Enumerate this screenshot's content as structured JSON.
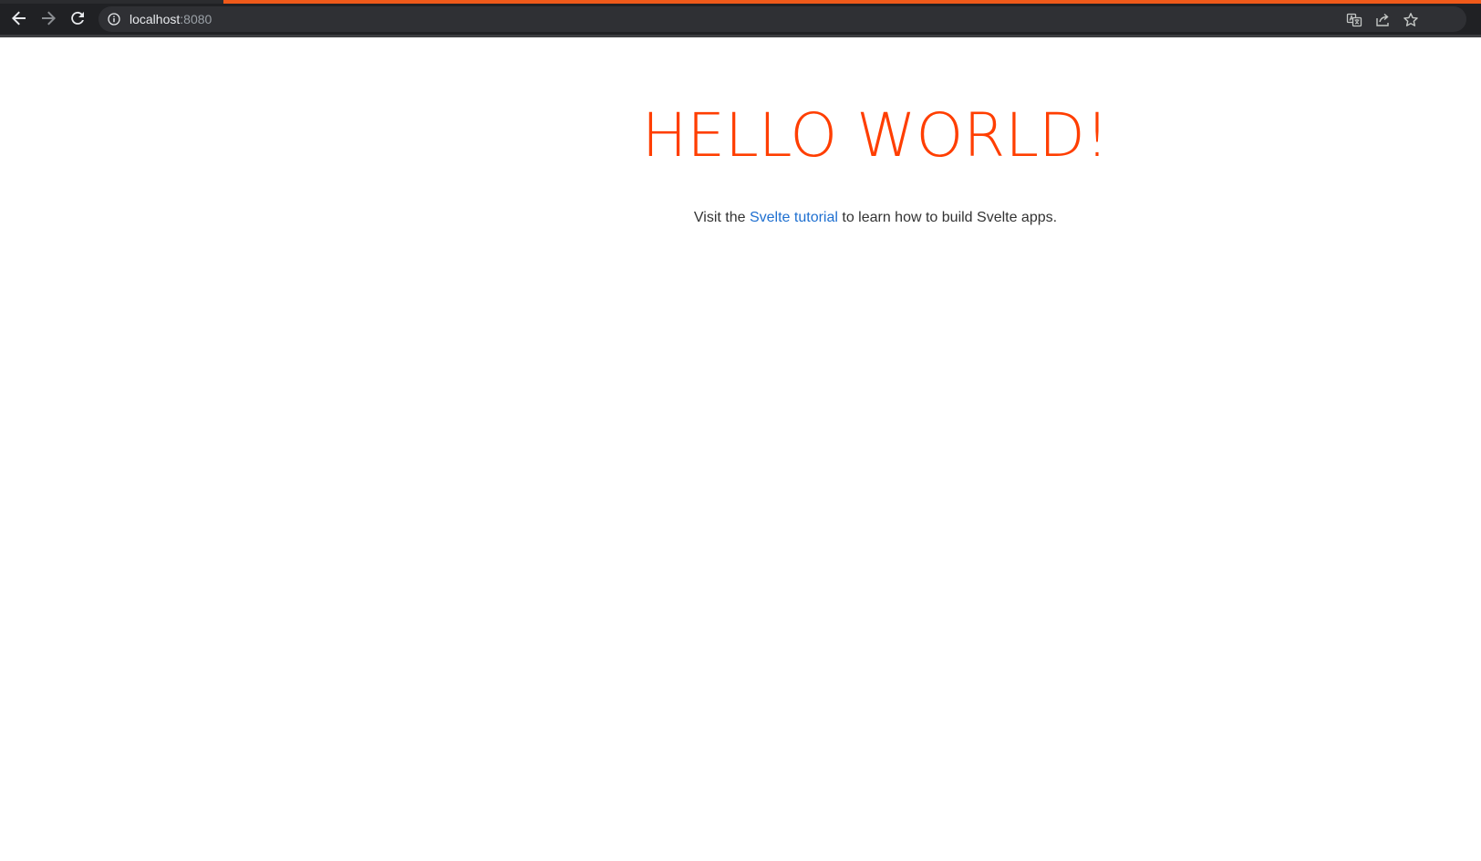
{
  "browser": {
    "url_host": "localhost",
    "url_port": ":8080",
    "accent_color": "#f05a1a",
    "icons": {
      "back": "arrow-left-icon",
      "forward": "arrow-right-icon",
      "reload": "reload-icon",
      "site_info": "info-icon",
      "translate": "translate-icon",
      "share": "share-icon",
      "bookmark": "star-icon"
    }
  },
  "page": {
    "heading": "HELLO WORLD!",
    "heading_color": "#ff3e00",
    "intro_before": "Visit the ",
    "link_text": "Svelte tutorial",
    "intro_after": " to learn how to build Svelte apps."
  }
}
